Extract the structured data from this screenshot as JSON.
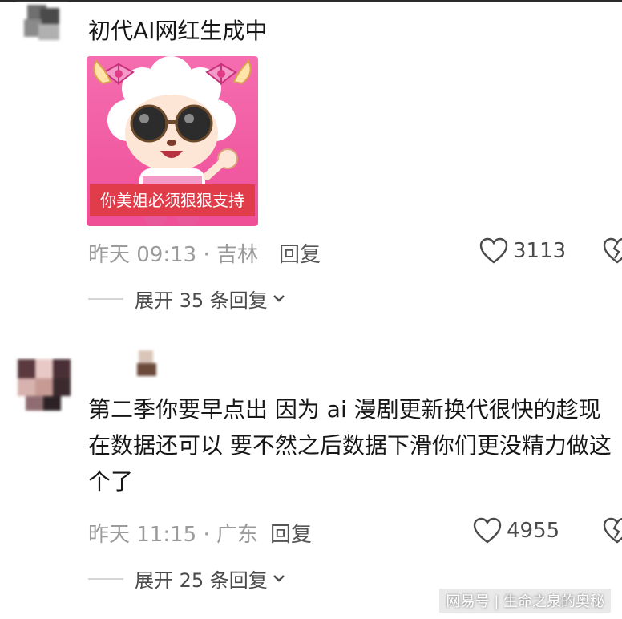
{
  "comments": [
    {
      "text": "初代AI网红生成中",
      "sticker": {
        "caption": "你美姐必须狠狠支持"
      },
      "meta": "昨天 09:13 · 吉林",
      "reply_label": "回复",
      "likes": "3113",
      "expand_label": "展开 35 条回复"
    },
    {
      "text": "第二季你要早点出 因为 ai 漫剧更新换代很快的趁现在数据还可以 要不然之后数据下滑你们更没精力做这个了",
      "meta": "昨天 11:15 · 广东",
      "reply_label": "回复",
      "likes": "4955",
      "expand_label": "展开 25 条回复"
    }
  ],
  "watermark": "网易号 | 生命之泉的奥秘",
  "colors": {
    "text": "#161616",
    "meta": "#9b9b9b",
    "sticker_bg": "#f25aa3",
    "caption_bg": "#e03c4a"
  },
  "icons": [
    "heart-icon",
    "dislike-icon",
    "chevron-down-icon"
  ]
}
